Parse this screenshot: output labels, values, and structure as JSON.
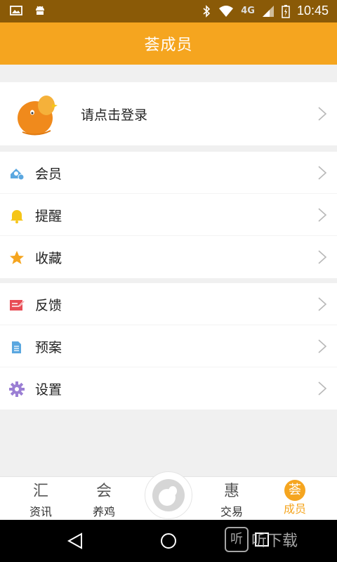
{
  "status_bar": {
    "time": "10:45",
    "network": "4G",
    "icons": [
      "image-icon",
      "android-icon",
      "bluetooth-icon",
      "wifi-icon",
      "signal-icon",
      "battery-icon"
    ]
  },
  "header": {
    "title": "荟成员"
  },
  "login": {
    "label": "请点击登录",
    "avatar_icon": "chick-avatar-icon"
  },
  "menu_groups": [
    {
      "items": [
        {
          "label": "会员",
          "icon": "member-icon",
          "color": "#5aa7e0"
        },
        {
          "label": "提醒",
          "icon": "bell-icon",
          "color": "#f5c518"
        },
        {
          "label": "收藏",
          "icon": "star-icon",
          "color": "#f5a51f"
        }
      ]
    },
    {
      "items": [
        {
          "label": "反馈",
          "icon": "feedback-icon",
          "color": "#e84d55"
        },
        {
          "label": "预案",
          "icon": "document-icon",
          "color": "#5aa7e0"
        },
        {
          "label": "设置",
          "icon": "gear-icon",
          "color": "#9b7fd4"
        }
      ]
    }
  ],
  "tabbar": {
    "tabs": [
      {
        "label": "资讯",
        "glyph": "汇",
        "active": false
      },
      {
        "label": "养鸡",
        "glyph": "会",
        "active": false
      },
      {
        "label": "交易",
        "glyph": "惠",
        "active": false
      },
      {
        "label": "成员",
        "glyph": "荟",
        "active": true
      }
    ]
  },
  "watermark": {
    "logo": "听",
    "text": "听下载"
  },
  "colors": {
    "accent": "#f5a51f",
    "statusbar": "#8a5a07"
  }
}
